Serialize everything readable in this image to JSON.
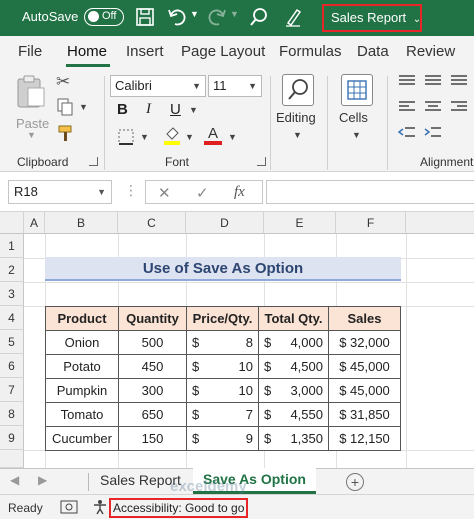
{
  "titlebar": {
    "autosave_label": "AutoSave",
    "autosave_state": "Off",
    "document_title": "Sales Report",
    "icons": [
      "save-icon",
      "undo-icon",
      "redo-icon",
      "search-icon",
      "pen-icon"
    ]
  },
  "ribbon": {
    "tabs": [
      "File",
      "Home",
      "Insert",
      "Page Layout",
      "Formulas",
      "Data",
      "Review"
    ],
    "active_tab": "Home",
    "clipboard": {
      "paste_label": "Paste",
      "group_label": "Clipboard"
    },
    "font": {
      "font_name": "Calibri",
      "font_size": "11",
      "bold": "B",
      "italic": "I",
      "underline": "U",
      "font_color_glyph": "A",
      "group_label": "Font"
    },
    "editing_label": "Editing",
    "cells_label": "Cells",
    "alignment_label": "Alignment"
  },
  "formula_bar": {
    "name_box": "R18",
    "cancel_glyph": "✕",
    "enter_glyph": "✓",
    "fx_glyph": "fx",
    "formula": ""
  },
  "grid": {
    "columns": [
      "A",
      "B",
      "C",
      "D",
      "E",
      "F"
    ],
    "rows": [
      "1",
      "2",
      "3",
      "4",
      "5",
      "6",
      "7",
      "8",
      "9"
    ]
  },
  "sheet": {
    "title": "Use of Save As Option",
    "headers": [
      "Product",
      "Quantity",
      "Price/Qty.",
      "Total Qty.",
      "Sales"
    ],
    "currency_symbol": "$",
    "rows": [
      {
        "product": "Onion",
        "quantity": "500",
        "price": "8",
        "total": "4,000",
        "sales": "$ 32,000"
      },
      {
        "product": "Potato",
        "quantity": "450",
        "price": "10",
        "total": "4,500",
        "sales": "$ 45,000"
      },
      {
        "product": "Pumpkin",
        "quantity": "300",
        "price": "10",
        "total": "3,000",
        "sales": "$ 45,000"
      },
      {
        "product": "Tomato",
        "quantity": "650",
        "price": "7",
        "total": "4,550",
        "sales": "$ 31,850"
      },
      {
        "product": "Cucumber",
        "quantity": "150",
        "price": "9",
        "total": "1,350",
        "sales": "$ 12,150"
      }
    ]
  },
  "sheet_tabs": {
    "tabs": [
      "Sales Report",
      "Save As Option"
    ],
    "active": "Save As Option"
  },
  "status": {
    "ready": "Ready",
    "accessibility": "Accessibility: Good to go"
  },
  "watermark": "exceldemy",
  "colors": {
    "excel_green": "#217346",
    "highlight_red": "#e8262a",
    "header_fill": "#fbe4d5",
    "title_fill": "#dde3f0"
  }
}
